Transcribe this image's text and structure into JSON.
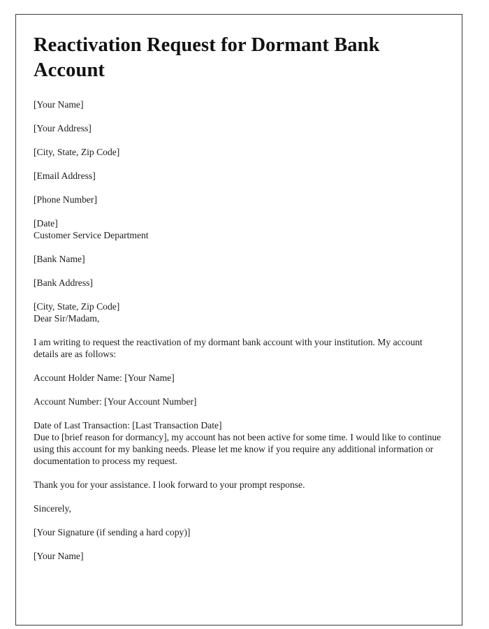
{
  "document": {
    "title": "Reactivation Request for Dormant Bank Account",
    "sender_block": [
      "[Your Name]",
      "[Your Address]",
      "[City, State, Zip Code]",
      "[Email Address]",
      "[Phone Number]",
      "[Date]"
    ],
    "recipient_block": [
      "Customer Service Department",
      "[Bank Name]",
      "[Bank Address]",
      "[City, State, Zip Code]"
    ],
    "salutation": "Dear Sir/Madam,",
    "intro_paragraph": "I am writing to request the reactivation of my dormant bank account with your institution. My account details are as follows:",
    "account_details": [
      "Account Holder Name: [Your Name]",
      "Account Number: [Your Account Number]",
      "Date of Last Transaction: [Last Transaction Date]"
    ],
    "body_paragraph": "Due to [brief reason for dormancy], my account has not been active for some time. I would like to continue using this account for my banking needs. Please let me know if you require any additional information or documentation to process my request.",
    "closing_paragraph": "Thank you for your assistance. I look forward to your prompt response.",
    "sign_off": "Sincerely,",
    "signature_line": "[Your Signature (if sending a hard copy)]",
    "signer_name": "[Your Name]"
  }
}
